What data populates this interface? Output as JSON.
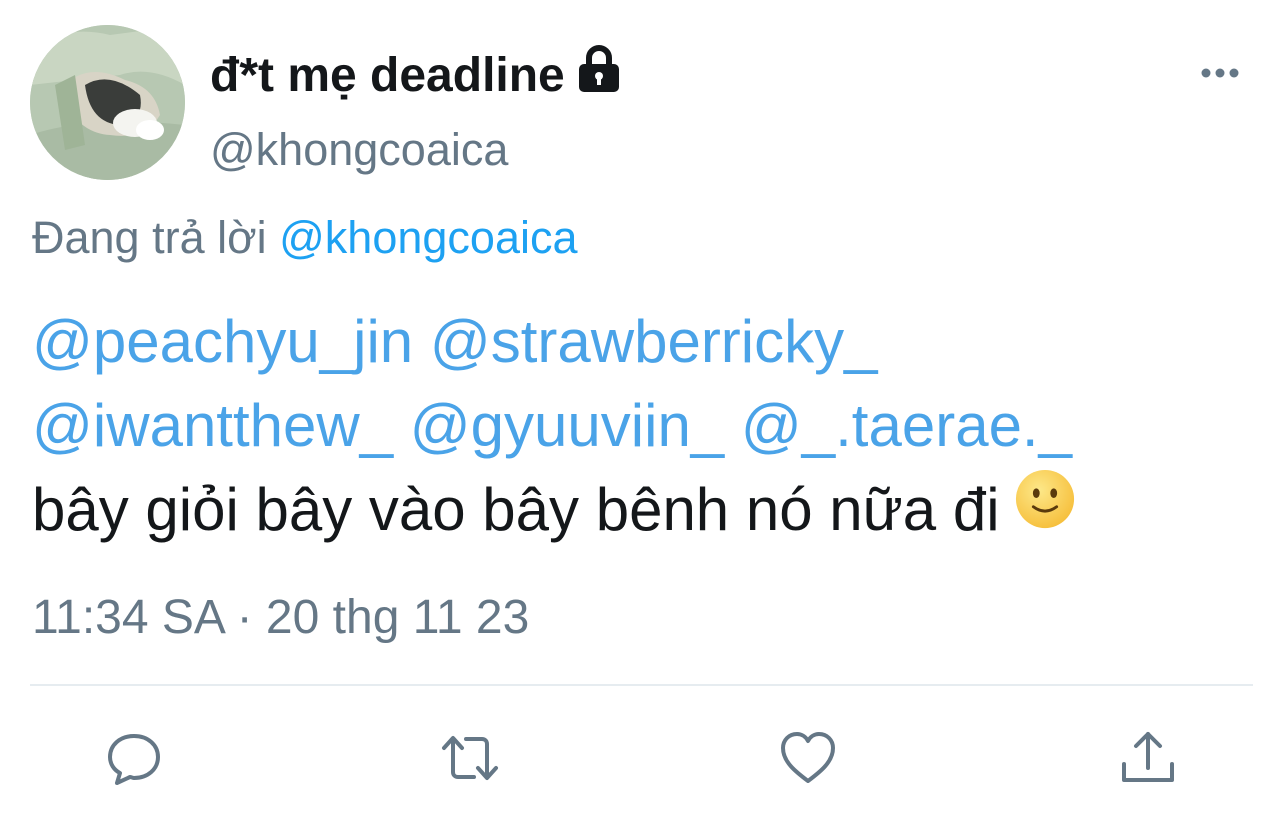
{
  "tweet": {
    "display_name": "đ*t mẹ deadline",
    "handle": "@khongcoaica",
    "replying_prefix": "Đang trả lời",
    "replying_to": "@khongcoaica",
    "mentions_line1": [
      "@peachyu_jin",
      "@strawberricky_"
    ],
    "mentions_line2": [
      "@iwantthew_",
      "@gyuuviin_",
      "@_.taerae._"
    ],
    "text": "bây giỏi bây vào bây bênh nó nữa đi",
    "timestamp": "11:34 SA · 20 thg 11 23"
  },
  "icons": {
    "lock": "lock-icon",
    "more": "more-options-icon",
    "emoji": "slightly-smiling-face-emoji",
    "reply": "reply-icon",
    "retweet": "retweet-icon",
    "like": "like-icon",
    "share": "share-icon"
  },
  "colors": {
    "link": "#1da1f2",
    "mention": "#4aa3e8",
    "secondary_text": "#657786",
    "primary_text": "#14171a",
    "divider": "#e6ecf0"
  }
}
